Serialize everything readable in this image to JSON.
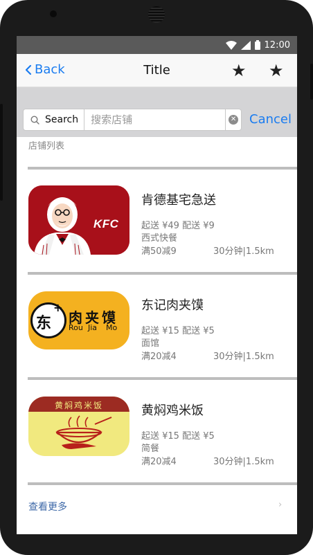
{
  "status_bar": {
    "time": "12:00"
  },
  "nav": {
    "back_label": "Back",
    "title": "Title"
  },
  "search": {
    "label": "Search",
    "placeholder": "搜索店铺",
    "cancel_label": "Cancel"
  },
  "section_label": "店铺列表",
  "stores": [
    {
      "name": "肯德基宅急送",
      "fees": "起送 ¥49  配送 ¥9",
      "category": "西式快餐",
      "promo": "满50减9",
      "distance": "30分钟|1.5km",
      "logo": {
        "text": "KFC",
        "colors": {
          "bg": "#a8101a",
          "text": "#ffffff"
        }
      }
    },
    {
      "name": "东记肉夹馍",
      "fees": "起送 ¥15  配送 ¥5",
      "category": "面馆",
      "promo": "满20减4",
      "distance": "30分钟|1.5km",
      "logo": {
        "circle_char": "东",
        "plus": "+",
        "title": "肉夹馍",
        "subtitle": [
          "Rou",
          "Jia",
          "Mo"
        ],
        "colors": {
          "bg": "#f4b120"
        }
      }
    },
    {
      "name": "黄焖鸡米饭",
      "fees": "起送 ¥15  配送 ¥5",
      "category": "简餐",
      "promo": "满20减4",
      "distance": "30分钟|1.5km",
      "logo": {
        "banner": "黄焖鸡米饭",
        "colors": {
          "banner": "#9c2b22",
          "bg": "#f1e97f"
        }
      }
    }
  ],
  "more_label": "查看更多",
  "colors": {
    "accent": "#1a7cf0",
    "link": "#3e69a8",
    "statusbar": "#5a5a5a",
    "divider": "#bdbdbd"
  }
}
